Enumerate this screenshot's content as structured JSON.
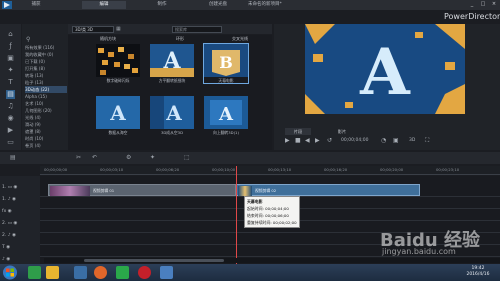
{
  "window": {
    "tabs": [
      "捕获",
      "编辑",
      "制作",
      "创建光盘"
    ],
    "active_tab": 1,
    "document_title": "未命名的新项目*",
    "brand": "PowerDirector",
    "controls": [
      "_",
      "□",
      "×"
    ]
  },
  "rail_icons": [
    "import-icon",
    "fx-icon",
    "pip-icon",
    "particle-icon",
    "title-icon",
    "transition-icon",
    "audio-icon",
    "voice-icon",
    "chapter-icon",
    "subtitle-icon"
  ],
  "categories": [
    {
      "label": "所有效果 (116)",
      "selected": false
    },
    {
      "label": "我的收藏中 (0)",
      "selected": false
    },
    {
      "label": "已下载 (0)",
      "selected": false
    },
    {
      "label": "打开集 (8)",
      "selected": false
    },
    {
      "label": "转场 (13)",
      "selected": false
    },
    {
      "label": "粒子 (13)",
      "selected": false
    },
    {
      "label": "3D动态 (22)",
      "selected": true
    },
    {
      "label": "Alpha (15)",
      "selected": false
    },
    {
      "label": "艺术 (10)",
      "selected": false
    },
    {
      "label": "几何图形 (20)",
      "selected": false
    },
    {
      "label": "光线 (4)",
      "selected": false
    },
    {
      "label": "滑动 (9)",
      "selected": false
    },
    {
      "label": "遮罩 (8)",
      "selected": false
    },
    {
      "label": "时尚 (10)",
      "selected": false
    },
    {
      "label": "卷页 (4)",
      "selected": false
    }
  ],
  "library": {
    "filter_value": "3D/类 3D",
    "search_placeholder": "搜索库",
    "headers": [
      "随机方块",
      "环形",
      "交叉光线"
    ],
    "thumbnails": [
      {
        "caption": "数字破碎闪烁",
        "style": "blocks"
      },
      {
        "caption": "方平翻转纸细块",
        "style": "letterA"
      },
      {
        "caption": "天幕电影",
        "style": "letterB"
      },
      {
        "caption": "数据从海空",
        "style": "blueA"
      },
      {
        "caption": "3D成从空3D",
        "style": "blueA2"
      },
      {
        "caption": "向上翻转3D(1)",
        "style": "blueStrip"
      }
    ]
  },
  "preview": {
    "tabs": [
      "片段",
      "影片"
    ],
    "zoom": "3D",
    "timecode": "00;00;04;00"
  },
  "timeline": {
    "tracks": [
      "1.",
      "1.",
      "fx",
      "2.",
      "2.",
      "T",
      "♪"
    ],
    "ruler_marks": [
      "00;00;00;00",
      "00;00;03;10",
      "00;00;06;20",
      "00;00;10;00",
      "00;00;13;10",
      "00;00;16;20",
      "00;00;20;00",
      "00;00;23;10"
    ],
    "clip1_label": "视频剪辑 01",
    "clip2_label": "视频剪辑 02",
    "tooltip": {
      "title": "天幕电影",
      "lines": [
        "起始时间: 00;00;04;00",
        "结束时间: 00;00;06;00",
        "重复持续时间: 00;00;02;00"
      ]
    }
  },
  "taskbar": {
    "time": "19:42",
    "date": "2016/4/16"
  },
  "watermark": {
    "text": "Baidu 经验",
    "url": "jingyan.baidu.com"
  }
}
